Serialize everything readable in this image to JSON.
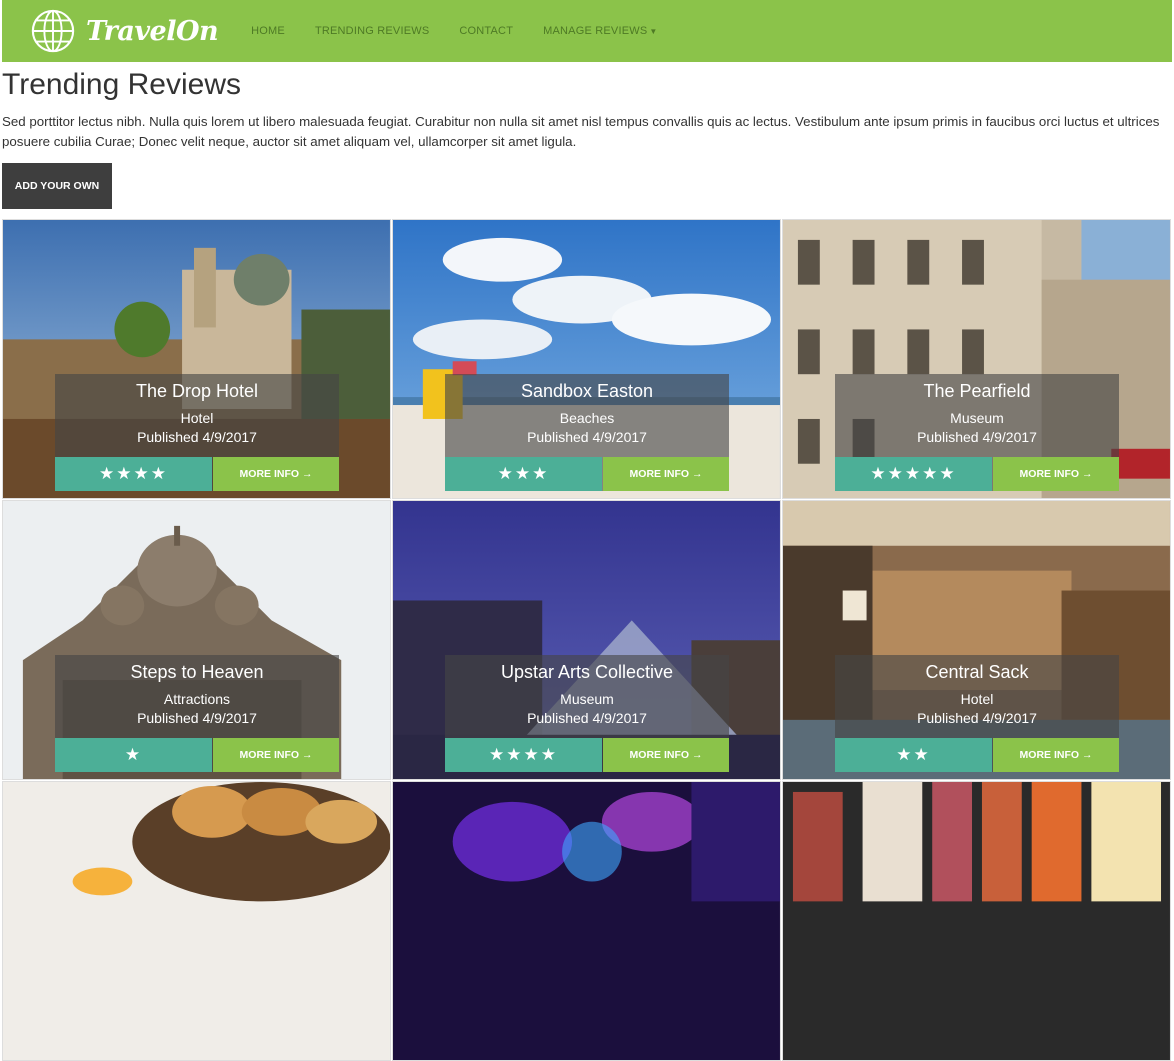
{
  "nav": {
    "brand": "TravelOn",
    "links": [
      "HOME",
      "TRENDING REVIEWS",
      "CONTACT",
      "MANAGE REVIEWS"
    ]
  },
  "header": {
    "title": "Trending Reviews",
    "intro": "Sed porttitor lectus nibh. Nulla quis lorem ut libero malesuada feugiat. Curabitur non nulla sit amet nisl tempus convallis quis ac lectus. Vestibulum ante ipsum primis in faucibus orci luctus et ultrices posuere cubilia Curae; Donec velit neque, auctor sit amet aliquam vel, ullamcorper sit amet ligula.",
    "add_label": "ADD YOUR OWN"
  },
  "cards": [
    {
      "title": "The Drop Hotel",
      "type": "Hotel",
      "published": "Published 4/9/2017",
      "stars": "★★★★",
      "rating": 4,
      "more": "MORE INFO →"
    },
    {
      "title": "Sandbox Easton",
      "type": "Beaches",
      "published": "Published 4/9/2017",
      "stars": "★★★",
      "rating": 3,
      "more": "MORE INFO →"
    },
    {
      "title": "The Pearfield",
      "type": "Museum",
      "published": "Published 4/9/2017",
      "stars": "★★★★★",
      "rating": 5,
      "more": "MORE INFO →"
    },
    {
      "title": "Steps to Heaven",
      "type": "Attractions",
      "published": "Published 4/9/2017",
      "stars": "★",
      "rating": 1,
      "more": "MORE INFO →"
    },
    {
      "title": "Upstar Arts Collective",
      "type": "Museum",
      "published": "Published 4/9/2017",
      "stars": "★★★★",
      "rating": 4,
      "more": "MORE INFO →"
    },
    {
      "title": "Central Sack",
      "type": "Hotel",
      "published": "Published 4/9/2017",
      "stars": "★★",
      "rating": 2,
      "more": "MORE INFO →"
    }
  ],
  "colors": {
    "nav_bg": "#8bc34a",
    "nav_link": "#4e7a25",
    "stars_bg": "#4caf97",
    "more_bg": "#8bc34a",
    "add_btn_bg": "#3e3e3e"
  }
}
